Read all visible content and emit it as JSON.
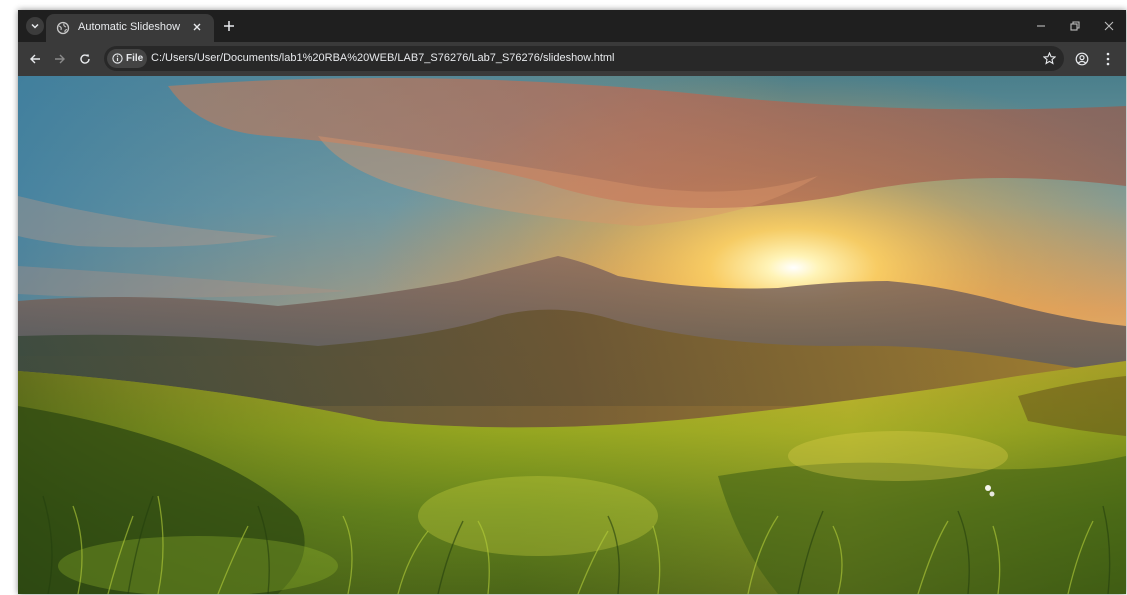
{
  "browser": {
    "tab_title": "Automatic Slideshow",
    "address_chip_label": "File",
    "url": "C:/Users/User/Documents/lab1%20RBA%20WEB/LAB7_S76276/Lab7_S76276/slideshow.html",
    "icons": {
      "tab_search": "chevron-down-icon",
      "favicon": "globe-icon",
      "tab_close": "close-icon",
      "new_tab": "plus-icon",
      "minimize": "minimize-icon",
      "restore": "restore-icon",
      "close_window": "close-icon",
      "back": "arrow-left-icon",
      "forward": "arrow-right-icon",
      "reload": "reload-icon",
      "site_info": "info-icon",
      "bookmark": "star-icon",
      "profile": "profile-icon",
      "menu": "kebab-menu-icon"
    },
    "colors": {
      "frame": "#1f1f1f",
      "toolbar": "#3a3a3a",
      "omnibox": "#282828",
      "text": "#e8eaed"
    }
  },
  "page": {
    "slide_image": "sunset-over-mountains-and-grassy-meadow"
  }
}
